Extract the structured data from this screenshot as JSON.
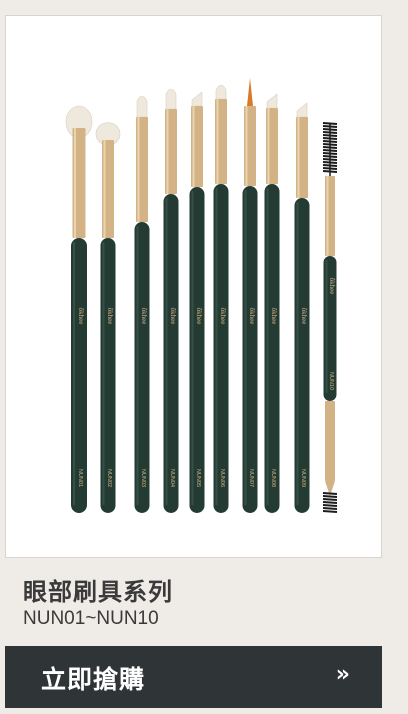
{
  "product": {
    "title": "眼部刷具系列",
    "code_range": "NUN01~NUN10",
    "image_alt_icon": "brush-set-image",
    "brand_mark": "ôkhee",
    "brush_codes": [
      "NUN01",
      "NUN02",
      "NUN03",
      "NUN04",
      "NUN05",
      "NUN06",
      "NUN07",
      "NUN08",
      "NUN09",
      "NUN10"
    ]
  },
  "cta": {
    "label": "立即搶購",
    "arrow": "»"
  },
  "colors": {
    "handle": "#233b33",
    "ferrule": "#d3b386",
    "bristle": "#efe8dc",
    "cta_bg": "#2f3437",
    "page_bg": "#efebe7"
  }
}
